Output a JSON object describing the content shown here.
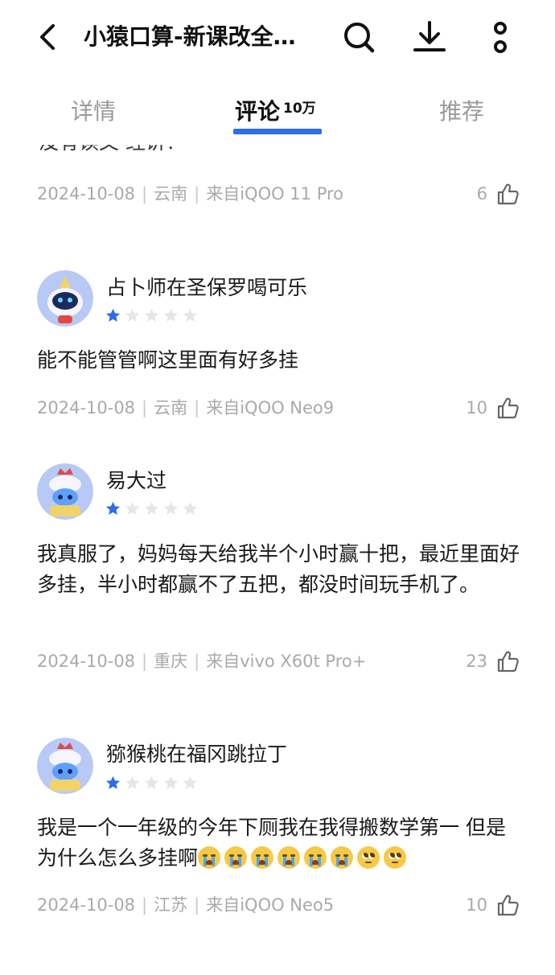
{
  "header": {
    "title": "小猿口算-新课改全…"
  },
  "tabs": [
    {
      "label": "详情"
    },
    {
      "label": "评论"
    },
    {
      "label": "推荐"
    }
  ],
  "comments_badge": "10万",
  "cut_comment": {
    "text_fragment": "没有读文 经讲！",
    "date": "2024-10-08",
    "region": "云南",
    "device": "来自iQOO 11 Pro",
    "likes": "6"
  },
  "comments": [
    {
      "username": "占卜师在圣保罗喝可乐",
      "rating": 1,
      "text": "能不能管管啊这里面有好多挂",
      "date": "2024-10-08",
      "region": "云南",
      "device": "来自iQOO Neo9",
      "likes": "10"
    },
    {
      "username": "易大过",
      "rating": 1,
      "text": "我真服了，妈妈每天给我半个小时赢十把，最近里面好多挂，半小时都赢不了五把，都没时间玩手机了。",
      "date": "2024-10-08",
      "region": "重庆",
      "device": "来自vivo X60t Pro+",
      "likes": "23"
    },
    {
      "username": "猕猴桃在福冈跳拉丁",
      "rating": 1,
      "text": "我是一个一年级的今年下厕我在我得搬数学第一 但是为什么怎么多挂啊",
      "date": "2024-10-08",
      "region": "江苏",
      "device": "来自iQOO Neo5",
      "likes": "10"
    }
  ],
  "colors": {
    "accent": "#2d6ee8",
    "star_filled": "#2d6ee8",
    "star_empty": "#e6e6e6",
    "meta_text": "#a9a9a9"
  }
}
